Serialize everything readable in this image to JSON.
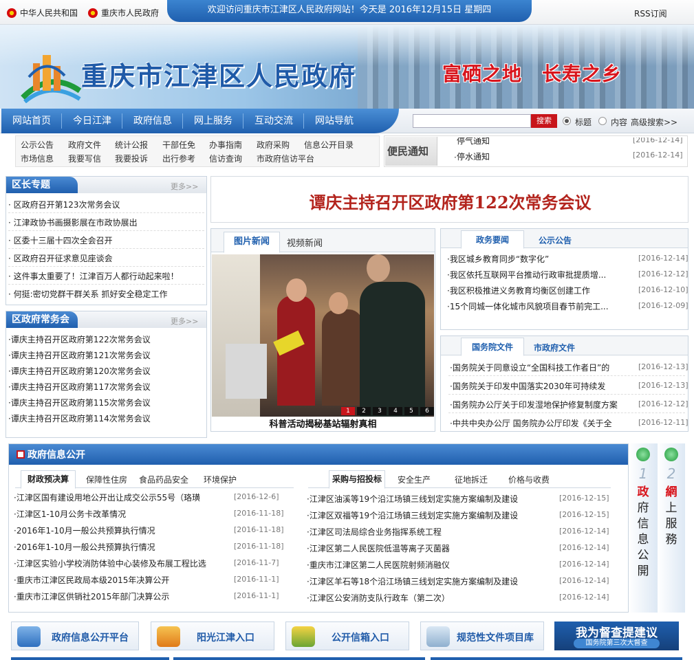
{
  "topbar": {
    "link1": "中华人民共和国",
    "link2": "重庆市人民政府",
    "welcome": "欢迎访问重庆市江津区人民政府网站！今天是 2016年12月15日 星期四",
    "rss": "RSS订阅"
  },
  "banner": {
    "title": "重庆市江津区人民政府",
    "slogan": "富硒之地　长寿之乡"
  },
  "nav": {
    "items": [
      "网站首页",
      "今日江津",
      "政府信息",
      "网上服务",
      "互动交流",
      "网站导航"
    ]
  },
  "search": {
    "button": "搜索",
    "opt_title": "标题",
    "opt_content": "内容",
    "advanced": "高级搜索>>"
  },
  "quick": {
    "row1": [
      "公示公告",
      "政府文件",
      "统计公报",
      "干部任免",
      "办事指南",
      "政府采购",
      "信息公开目录"
    ],
    "row2": [
      "市场信息",
      "我要写信",
      "我要投诉",
      "出行参考",
      "信访查询",
      "市政府信访平台"
    ]
  },
  "notice": {
    "label": "便民通知",
    "items": [
      {
        "text": "停气通知",
        "date": "[2016-12-14]"
      },
      {
        "text": "停水通知",
        "date": "[2016-12-14]"
      }
    ]
  },
  "mayor": {
    "title": "区长专题",
    "more": "更多>>",
    "items": [
      "区政府召开第123次常务会议",
      "江津政协书画摄影展在市政协展出",
      "区委十三届十四次全会召开",
      "区政府召开征求意见座谈会",
      "这件事太重要了！江津百万人都行动起来啦！",
      "何挺:密切党群干群关系 抓好安全稳定工作"
    ]
  },
  "meeting": {
    "title": "区政府常务会",
    "more": "更多>>",
    "items": [
      "谭庆主持召开区政府第122次常务会议",
      "谭庆主持召开区政府第121次常务会议",
      "谭庆主持召开区政府第120次常务会议",
      "谭庆主持召开区政府第117次常务会议",
      "谭庆主持召开区政府第115次常务会议",
      "谭庆主持召开区政府第114次常务会议"
    ]
  },
  "headline": "谭庆主持召开区政府第122次常务会议",
  "photo": {
    "tab1": "图片新闻",
    "tab2": "视频新闻",
    "caption": "科普活动揭秘基站辐射真相",
    "pages": [
      "1",
      "2",
      "3",
      "4",
      "5",
      "6"
    ]
  },
  "gov_news": {
    "tab1": "政务要闻",
    "tab2": "公示公告",
    "items": [
      {
        "text": "我区城乡教育同步“数字化”",
        "date": "[2016-12-14]"
      },
      {
        "text": "我区依托互联网平台推动行政审批提质增...",
        "date": "[2016-12-12]"
      },
      {
        "text": "我区积极推进义务教育均衡区创建工作",
        "date": "[2016-12-10]"
      },
      {
        "text": "15个同城一体化城市风貌项目春节前完工...",
        "date": "[2016-12-09]"
      }
    ]
  },
  "docs": {
    "tab1": "国务院文件",
    "tab2": "市政府文件",
    "items": [
      {
        "text": "国务院关于同意设立“全国科技工作者日”的",
        "date": "[2016-12-13]"
      },
      {
        "text": "国务院关于印发中国落实2030年可持续发",
        "date": "[2016-12-13]"
      },
      {
        "text": "国务院办公厅关于印发湿地保护修复制度方案",
        "date": "[2016-12-12]"
      },
      {
        "text": "中共中央办公厅 国务院办公厅印发《关于全",
        "date": "[2016-12-11]"
      }
    ]
  },
  "open_info": {
    "title": "政府信息公开",
    "left_tabs": [
      "财政预决算",
      "保障性住房",
      "食品药品安全",
      "环境保护"
    ],
    "left_items": [
      {
        "text": "江津区国有建设用地公开出让成交公示55号（珞璜",
        "date": "[2016-12-6]"
      },
      {
        "text": "江津区1-10月公务卡改革情况",
        "date": "[2016-11-18]"
      },
      {
        "text": "2016年1-10月一般公共预算执行情况",
        "date": "[2016-11-18]"
      },
      {
        "text": "2016年1-10月一般公共预算执行情况",
        "date": "[2016-11-18]"
      },
      {
        "text": "江津区实验小学校消防体验中心装修及布展工程比选",
        "date": "[2016-11-7]"
      },
      {
        "text": "重庆市江津区民政局本级2015年决算公开",
        "date": "[2016-11-1]"
      },
      {
        "text": "重庆市江津区供销社2015年部门决算公示",
        "date": "[2016-11-1]"
      }
    ],
    "right_tabs": [
      "采购与招投标",
      "安全生产",
      "征地拆迁",
      "价格与收费"
    ],
    "right_items": [
      {
        "text": "江津区油溪等19个沿江场镇三线划定实施方案编制及建设",
        "date": "[2016-12-15]"
      },
      {
        "text": "江津区双福等19个沿江场镇三线划定实施方案编制及建设",
        "date": "[2016-12-15]"
      },
      {
        "text": "江津区司法局综合业务指挥系统工程",
        "date": "[2016-12-14]"
      },
      {
        "text": "江津区第二人民医院低温等离子灭菌器",
        "date": "[2016-12-14]"
      },
      {
        "text": "重庆市江津区第二人民医院射频消融仪",
        "date": "[2016-12-14]"
      },
      {
        "text": "江津区羊石等18个沿江场镇三线划定实施方案编制及建设",
        "date": "[2016-12-14]"
      },
      {
        "text": "江津区公安消防支队行政车（第二次）",
        "date": "[2016-12-14]"
      }
    ]
  },
  "side_tabs": {
    "tab1_num": "1",
    "tab1": [
      "政",
      "府",
      "信",
      "息",
      "公",
      "開"
    ],
    "tab2_num": "2",
    "tab2": [
      "網",
      "上",
      "服",
      "務"
    ]
  },
  "entries": {
    "e1": "政府信息公开平台",
    "e2": "阳光江津入口",
    "e3": "公开信箱入口",
    "e4": "规范性文件项目库",
    "e5_title": "我为督查提建议",
    "e5_sub": "国务院第三次大督查"
  },
  "colors": {
    "brand_blue": "#1f5fae",
    "headline_red": "#b3241d",
    "slogan_red": "#d8141c"
  }
}
